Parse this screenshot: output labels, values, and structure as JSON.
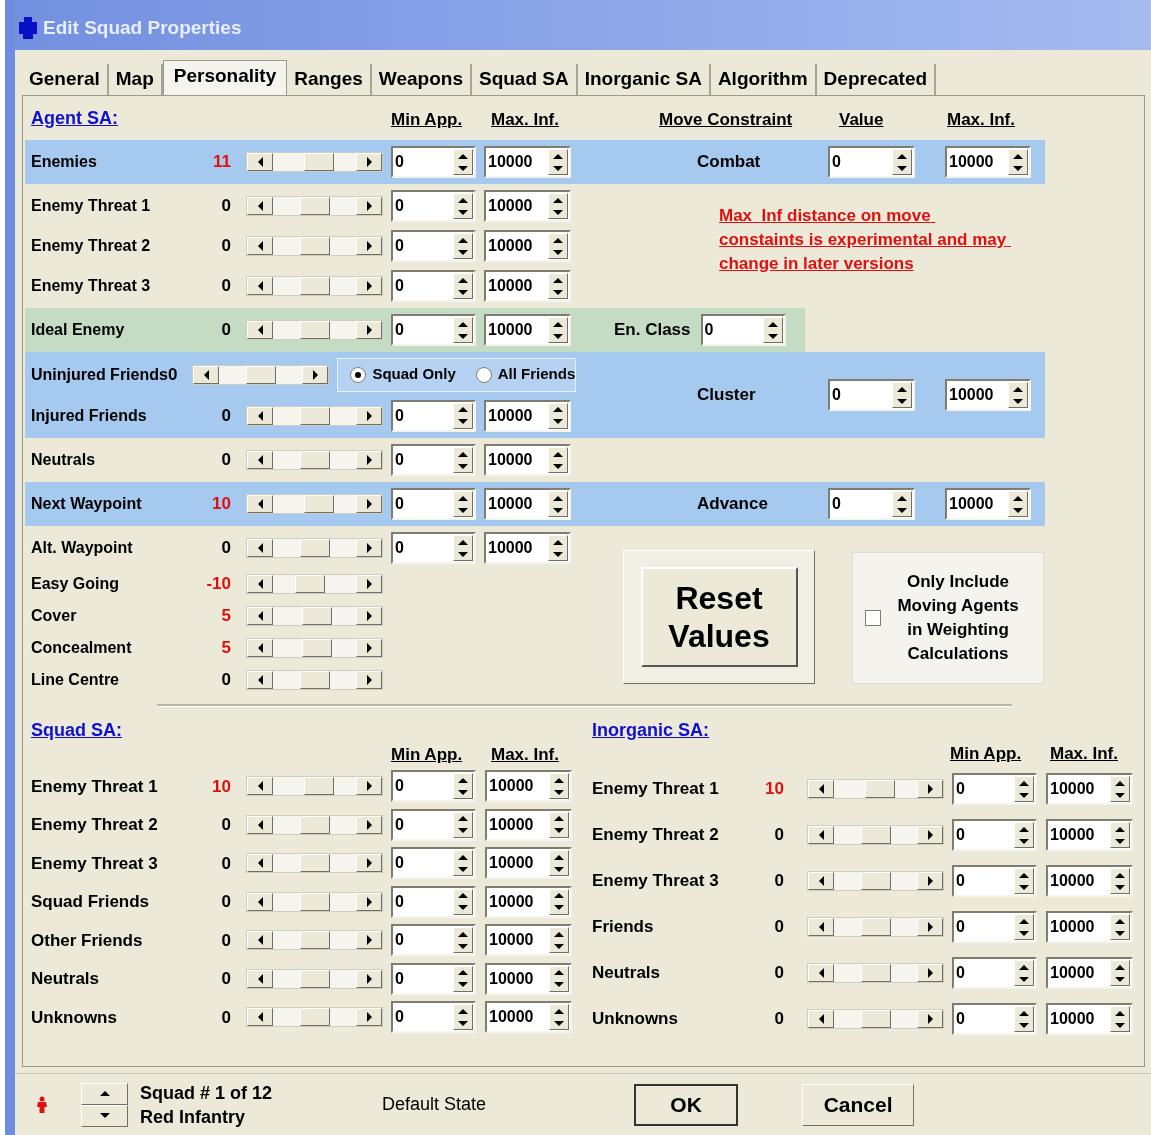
{
  "window": {
    "title": "Edit Squad Properties"
  },
  "tabs": [
    {
      "label": "General",
      "selected": false
    },
    {
      "label": "Map",
      "selected": false
    },
    {
      "label": "Personality",
      "selected": true
    },
    {
      "label": "Ranges",
      "selected": false
    },
    {
      "label": "Weapons",
      "selected": false
    },
    {
      "label": "Squad SA",
      "selected": false
    },
    {
      "label": "Inorganic SA",
      "selected": false
    },
    {
      "label": "Algorithm",
      "selected": false
    },
    {
      "label": "Deprecated",
      "selected": false
    }
  ],
  "agent_sa": {
    "title": "Agent SA:",
    "headers": {
      "min": "Min App.",
      "max": "Max. Inf.",
      "move": "Move Constraint",
      "value": "Value",
      "move_max": "Max. Inf."
    },
    "blocks": [
      {
        "color": "#a6c9ef",
        "rows": [
          {
            "label": "Enemies",
            "value": "11",
            "color": "#e01010",
            "level": 0.56,
            "kind": "spin",
            "min": "0",
            "max": "10000"
          }
        ],
        "move": {
          "label": "Combat",
          "value": "0",
          "max": "10000"
        }
      },
      {
        "rows": [
          {
            "label": "Enemy Threat 1",
            "value": "0",
            "color": "#000000",
            "level": 0.5,
            "kind": "spin",
            "min": "0",
            "max": "10000"
          },
          {
            "label": "Enemy Threat 2",
            "value": "0",
            "color": "#000000",
            "level": 0.5,
            "kind": "spin",
            "min": "0",
            "max": "10000"
          },
          {
            "label": "Enemy Threat 3",
            "value": "0",
            "color": "#000000",
            "level": 0.5,
            "kind": "spin",
            "min": "0",
            "max": "10000"
          }
        ],
        "note": "Max  Inf distance on move constaints is experimental and may change in later versions"
      },
      {
        "color": "#c3dcc3",
        "rows": [
          {
            "label": "Ideal Enemy",
            "value": "0",
            "color": "#000000",
            "level": 0.5,
            "kind": "spin",
            "min": "0",
            "max": "10000"
          }
        ],
        "en_class": {
          "label": "En. Class",
          "value": "0"
        }
      },
      {
        "color": "#a6c9ef",
        "rows": [
          {
            "label": "Uninjured Friends",
            "value": "0",
            "color": "#000000",
            "level": 0.5,
            "kind": "radio",
            "radios": [
              {
                "label": "Squad Only",
                "selected": true
              },
              {
                "label": "All Friends",
                "selected": false
              }
            ]
          },
          {
            "label": "Injured Friends",
            "value": "0",
            "color": "#000000",
            "level": 0.5,
            "kind": "spin",
            "min": "0",
            "max": "10000"
          }
        ],
        "move": {
          "label": "Cluster",
          "value": "0",
          "max": "10000"
        }
      },
      {
        "rows": [
          {
            "label": "Neutrals",
            "value": "0",
            "color": "#000000",
            "level": 0.5,
            "kind": "spin",
            "min": "0",
            "max": "10000"
          }
        ]
      },
      {
        "color": "#a6c9ef",
        "rows": [
          {
            "label": "Next Waypoint",
            "value": "10",
            "color": "#e01010",
            "level": 0.55,
            "kind": "spin",
            "min": "0",
            "max": "10000"
          }
        ],
        "move": {
          "label": "Advance",
          "value": "0",
          "max": "10000"
        }
      },
      {
        "rows": [
          {
            "label": "Alt. Waypoint",
            "value": "0",
            "color": "#000000",
            "level": 0.5,
            "kind": "spin",
            "min": "0",
            "max": "10000"
          },
          {
            "label": "Easy Going",
            "value": "-10",
            "color": "#e01010",
            "level": 0.45,
            "kind": "plain"
          },
          {
            "label": "Cover",
            "value": "5",
            "color": "#e01010",
            "level": 0.53,
            "kind": "plain"
          },
          {
            "label": "Concealment",
            "value": "5",
            "color": "#e01010",
            "level": 0.53,
            "kind": "plain"
          },
          {
            "label": "Line Centre",
            "value": "0",
            "color": "#000000",
            "level": 0.5,
            "kind": "plain"
          }
        ],
        "reset": "Reset Values",
        "checkbox": {
          "label": "Only Include Moving Agents in Weighting Calculations",
          "checked": false
        }
      }
    ]
  },
  "squad_sa": {
    "title": "Squad SA:",
    "headers": {
      "min": "Min App.",
      "max": "Max. Inf."
    },
    "rows": [
      {
        "label": "Enemy Threat 1",
        "value": "10",
        "color": "#e01010",
        "level": 0.55,
        "min": "0",
        "max": "10000"
      },
      {
        "label": "Enemy Threat 2",
        "value": "0",
        "color": "#000000",
        "level": 0.5,
        "min": "0",
        "max": "10000"
      },
      {
        "label": "Enemy Threat 3",
        "value": "0",
        "color": "#000000",
        "level": 0.5,
        "min": "0",
        "max": "10000"
      },
      {
        "label": "Squad Friends",
        "value": "0",
        "color": "#000000",
        "level": 0.5,
        "min": "0",
        "max": "10000"
      },
      {
        "label": "Other Friends",
        "value": "0",
        "color": "#000000",
        "level": 0.5,
        "min": "0",
        "max": "10000"
      },
      {
        "label": "Neutrals",
        "value": "0",
        "color": "#000000",
        "level": 0.5,
        "min": "0",
        "max": "10000"
      },
      {
        "label": "Unknowns",
        "value": "0",
        "color": "#000000",
        "level": 0.5,
        "min": "0",
        "max": "10000"
      }
    ]
  },
  "inorganic_sa": {
    "title": "Inorganic SA:",
    "headers": {
      "min": "Min App.",
      "max": "Max. Inf."
    },
    "rows": [
      {
        "label": "Enemy Threat 1",
        "value": "10",
        "color": "#e01010",
        "level": 0.55,
        "min": "0",
        "max": "10000"
      },
      {
        "label": "Enemy Threat 2",
        "value": "0",
        "color": "#000000",
        "level": 0.5,
        "min": "0",
        "max": "10000"
      },
      {
        "label": "Enemy Threat 3",
        "value": "0",
        "color": "#000000",
        "level": 0.5,
        "min": "0",
        "max": "10000"
      },
      {
        "label": "Friends",
        "value": "0",
        "color": "#000000",
        "level": 0.5,
        "min": "0",
        "max": "10000"
      },
      {
        "label": "Neutrals",
        "value": "0",
        "color": "#000000",
        "level": 0.5,
        "min": "0",
        "max": "10000"
      },
      {
        "label": "Unknowns",
        "value": "0",
        "color": "#000000",
        "level": 0.5,
        "min": "0",
        "max": "10000"
      }
    ]
  },
  "footer": {
    "squad": "Squad # 1 of 12",
    "name": "Red Infantry",
    "state": "Default State",
    "ok": "OK",
    "cancel": "Cancel"
  }
}
